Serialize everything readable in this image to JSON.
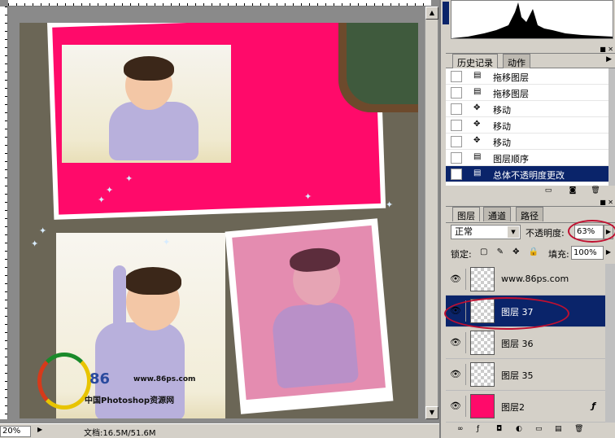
{
  "canvas": {
    "zoom": "20%",
    "doc_info": "文档:16.5M/51.6M",
    "logo": {
      "brand": "86",
      "url": "www.86ps.com",
      "site_name": "中国Photoshop资源网"
    }
  },
  "history_panel": {
    "tabs": [
      "历史记录",
      "动作"
    ],
    "items": [
      {
        "label": "拖移图层",
        "icon": "document-icon"
      },
      {
        "label": "拖移图层",
        "icon": "document-icon"
      },
      {
        "label": "移动",
        "icon": "move-icon"
      },
      {
        "label": "移动",
        "icon": "move-icon"
      },
      {
        "label": "移动",
        "icon": "move-icon"
      },
      {
        "label": "图层顺序",
        "icon": "document-icon"
      },
      {
        "label": "总体不透明度更改",
        "icon": "document-icon",
        "selected": true
      }
    ]
  },
  "layers_panel": {
    "tabs": [
      "图层",
      "通道",
      "路径"
    ],
    "blend_mode": "正常",
    "opacity_label": "不透明度:",
    "opacity_value": "63%",
    "lock_label": "锁定:",
    "fill_label": "填充:",
    "fill_value": "100%",
    "layers": [
      {
        "name": "www.86ps.com",
        "visible": true
      },
      {
        "name": "图层 37",
        "visible": true,
        "selected": true
      },
      {
        "name": "图层 36",
        "visible": true
      },
      {
        "name": "图层 35",
        "visible": true
      },
      {
        "name": "图层2",
        "visible": true,
        "fx": true
      }
    ]
  },
  "colors": {
    "selection": "#0a246a",
    "pink_card": "#ff0a6a",
    "annotation_circle": "#c01030"
  }
}
